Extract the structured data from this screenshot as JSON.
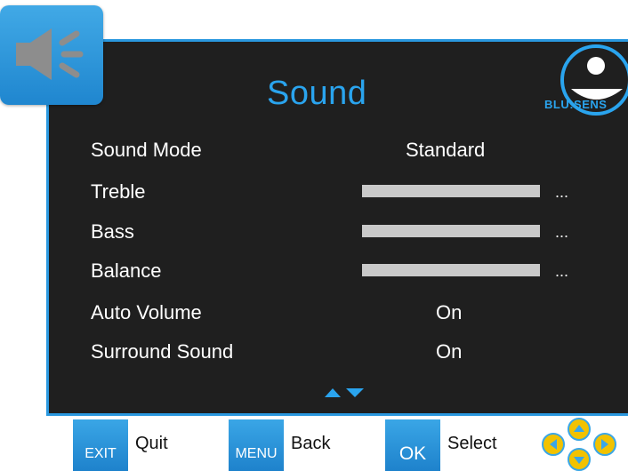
{
  "menu": {
    "title": "Sound",
    "brand": "BLU:SENS",
    "items": [
      {
        "label": "Sound Mode",
        "value": "Standard",
        "type": "option"
      },
      {
        "label": "Treble",
        "value": "...",
        "type": "slider"
      },
      {
        "label": "Bass",
        "value": "...",
        "type": "slider"
      },
      {
        "label": "Balance",
        "value": "...",
        "type": "slider"
      },
      {
        "label": "Auto Volume",
        "value": "On",
        "type": "option"
      },
      {
        "label": "Surround Sound",
        "value": "On",
        "type": "option"
      }
    ]
  },
  "footer": {
    "exit_key": "EXIT",
    "exit_label": "Quit",
    "menu_key": "MENU",
    "menu_label": "Back",
    "ok_key": "OK",
    "ok_label": "Select"
  },
  "colors": {
    "accent": "#2aa4ee",
    "panel_bg": "#1f1f1f",
    "slider": "#c9c9c9",
    "dpad": "#f2c200"
  },
  "icons": [
    "speaker-icon",
    "scroll-arrows-icon",
    "dpad-icon",
    "brand-logo-icon"
  ]
}
